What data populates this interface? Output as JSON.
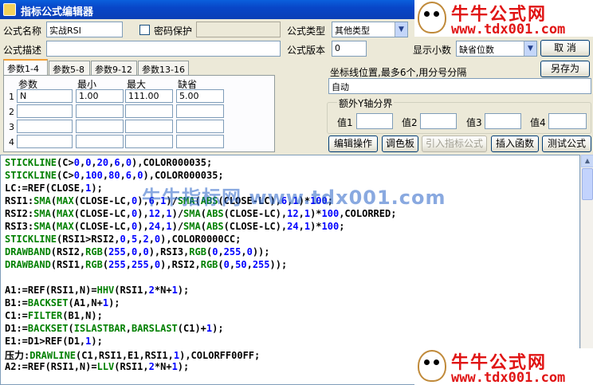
{
  "window": {
    "title": "指标公式编辑器"
  },
  "form": {
    "name_label": "公式名称",
    "name_value": "实战RSI",
    "password_label": "密码保护",
    "desc_label": "公式描述",
    "desc_value": "",
    "type_label": "公式类型",
    "type_value": "其他类型",
    "version_label": "公式版本",
    "version_value": "0",
    "decimals_label": "显示小数",
    "decimals_value": "缺省位数"
  },
  "buttons": {
    "cancel": "取 消",
    "save_as": "另存为",
    "edit_ops": "编辑操作",
    "palette": "调色板",
    "import_formula": "引入指标公式",
    "insert_func": "插入函数",
    "test_formula": "测试公式"
  },
  "param_tabs": [
    "参数1-4",
    "参数5-8",
    "参数9-12",
    "参数13-16"
  ],
  "param_table": {
    "headers": [
      "参数",
      "最小",
      "最大",
      "缺省"
    ],
    "rows": [
      {
        "n": "1",
        "name": "N",
        "min": "1.00",
        "max": "111.00",
        "def": "5.00"
      },
      {
        "n": "2",
        "name": "",
        "min": "",
        "max": "",
        "def": ""
      },
      {
        "n": "3",
        "name": "",
        "min": "",
        "max": "",
        "def": ""
      },
      {
        "n": "4",
        "name": "",
        "min": "",
        "max": "",
        "def": ""
      }
    ]
  },
  "axis": {
    "label": "坐标线位置,最多6个,用分号分隔",
    "value": "自动"
  },
  "extra_axis": {
    "label": "额外Y轴分界",
    "values": [
      "值1",
      "值2",
      "值3",
      "值4"
    ]
  },
  "code_lines": [
    "STICKLINE(C>0,0,20,6,0),COLOR000035;",
    "STICKLINE(C>0,100,80,6,0),COLOR000035;",
    "LC:=REF(CLOSE,1);",
    "RSI1:SMA(MAX(CLOSE-LC,0),6,1)/SMA(ABS(CLOSE-LC),6,1)*100;",
    "RSI2:SMA(MAX(CLOSE-LC,0),12,1)/SMA(ABS(CLOSE-LC),12,1)*100,COLORRED;",
    "RSI3:SMA(MAX(CLOSE-LC,0),24,1)/SMA(ABS(CLOSE-LC),24,1)*100;",
    "STICKLINE(RSI1>RSI2,0,5,2,0),COLOR0000CC;",
    "DRAWBAND(RSI2,RGB(255,0,0),RSI3,RGB(0,255,0));",
    "DRAWBAND(RSI1,RGB(255,255,0),RSI2,RGB(0,50,255));",
    "",
    "A1:=REF(RSI1,N)=HHV(RSI1,2*N+1);",
    "B1:=BACKSET(A1,N+1);",
    "C1:=FILTER(B1,N);",
    "D1:=BACKSET(ISLASTBAR,BARSLAST(C1)+1);",
    "E1:=D1>REF(D1,1);",
    "压力:DRAWLINE(C1,RSI1,E1,RSI1,1),COLORFF00FF;",
    "A2:=REF(RSI1,N)=LLV(RSI1,2*N+1);"
  ],
  "watermark": {
    "brand": "牛牛公式网",
    "url": "www.tdx001.com",
    "center_text": "牛牛指标网 www.tdx001.com"
  },
  "colors": {
    "keyword": "#008000",
    "number": "#0000ff",
    "text": "#000000",
    "watermark": "#e01414"
  }
}
